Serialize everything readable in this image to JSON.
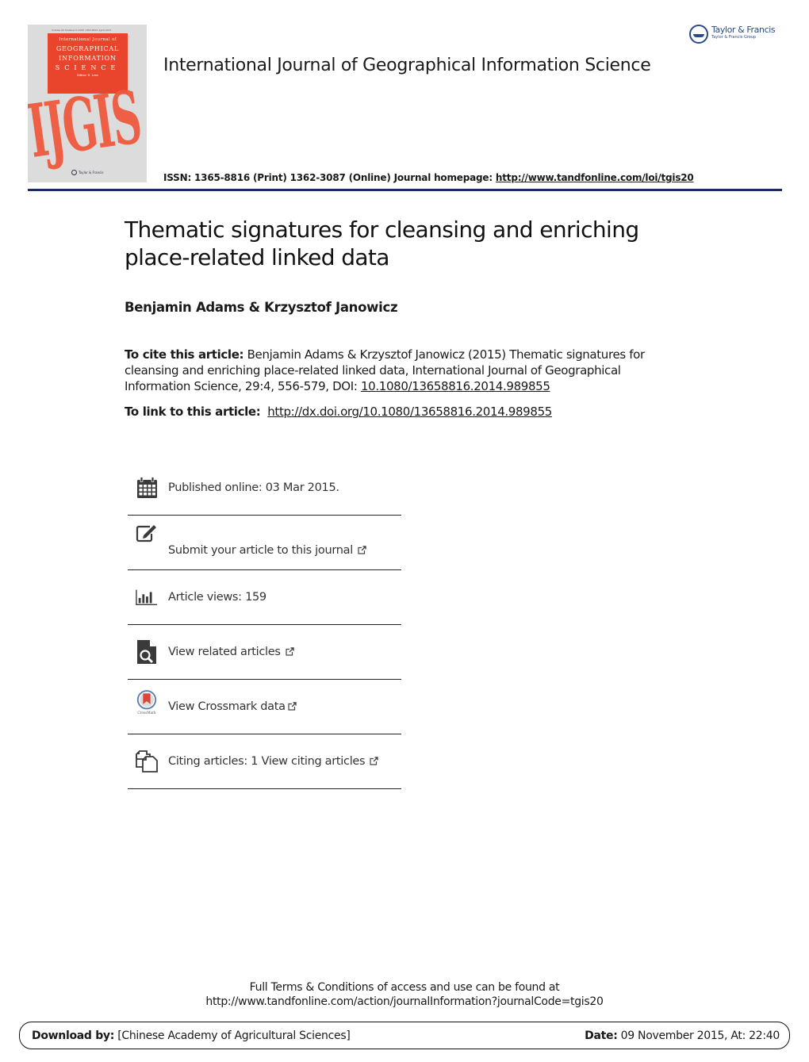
{
  "cover": {
    "meta": "Volume 00 Number 0 ISSN 1365-8816 April 2015",
    "line1": "International Journal of",
    "line2": "GEOGRAPHICAL",
    "line3": "INFORMATION",
    "line4": "SCIENCE",
    "editor": "Editor: B. Lees",
    "big_text": "IJGIS",
    "publisher": "Taylor & Francis",
    "publisher_group": "Taylor & Francis Group"
  },
  "header": {
    "journal_title": "International Journal of Geographical Information Science",
    "publisher_logo": {
      "name": "Taylor & Francis",
      "group": "Taylor & Francis Group",
      "color": "#2a4a8c"
    },
    "issn_text": "ISSN: 1365-8816 (Print) 1362-3087 (Online) Journal homepage: ",
    "homepage_url": "http://www.tandfonline.com/loi/tgis20",
    "rule_color": "#1b2a6b"
  },
  "article": {
    "title": "Thematic signatures for cleansing and enriching place-related linked data",
    "authors": "Benjamin Adams & Krzysztof Janowicz",
    "cite_label": "To cite this article:",
    "cite_text": " Benjamin Adams & Krzysztof Janowicz (2015) Thematic signatures for cleansing and enriching place-related linked data, International Journal of Geographical Information Science, 29:4, 556-579, DOI: ",
    "doi": "10.1080/13658816.2014.989855",
    "link_label": "To link to this article:",
    "link_url": "http://dx.doi.org/10.1080/13658816.2014.989855"
  },
  "info_items": [
    {
      "icon": "calendar-icon",
      "text": "Published online: 03 Mar 2015.",
      "external": false
    },
    {
      "icon": "edit-icon",
      "text": "Submit your article to this journal",
      "external": true
    },
    {
      "icon": "bar-chart-icon",
      "text": "Article views: 159",
      "external": false
    },
    {
      "icon": "search-document-icon",
      "text": "View related articles",
      "external": true
    },
    {
      "icon": "crossmark-icon",
      "text": "View Crossmark data",
      "external": true
    },
    {
      "icon": "citing-articles-icon",
      "text": "Citing articles: 1 View citing articles",
      "external": true
    }
  ],
  "footer": {
    "terms_line1": "Full Terms & Conditions of access and use can be found at",
    "terms_line2": "http://www.tandfonline.com/action/journalInformation?journalCode=tgis20",
    "download_label": "Download by:",
    "download_value": " [Chinese Academy of Agricultural Sciences]",
    "date_label": "Date:",
    "date_value": " 09 November 2015, At: 22:40"
  }
}
